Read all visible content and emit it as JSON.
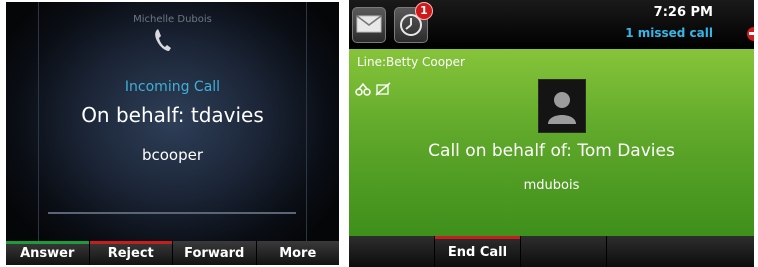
{
  "incoming_screen": {
    "caller_name": "Michelle Dubois",
    "status": "Incoming Call",
    "on_behalf": "On behalf: tdavies",
    "extension": "bcooper",
    "softkeys": [
      {
        "label": "Answer",
        "color": "#1e9b3a"
      },
      {
        "label": "Reject",
        "color": "#c41e1e"
      },
      {
        "label": "Forward",
        "color": ""
      },
      {
        "label": "More",
        "color": ""
      }
    ],
    "icons": {
      "handset": "handset-icon"
    }
  },
  "active_screen": {
    "time": "7:26 PM",
    "missed_calls": "1 missed call",
    "message_badge": "1",
    "line_label": "Line:Betty Cooper",
    "call_on_behalf": "Call on behalf of: Tom Davies",
    "remote_party": "mdubois",
    "softkeys": [
      {
        "label": "",
        "color": ""
      },
      {
        "label": "End Call",
        "color": "#c41e1e"
      },
      {
        "label": "",
        "color": ""
      },
      {
        "label": "",
        "color": ""
      }
    ],
    "icons": {
      "messages": "envelope-icon",
      "recent_calls": "clock-icon",
      "avatar": "contact-avatar-icon",
      "dnd": "do-not-disturb-icon",
      "forward_status": "forward-icon",
      "mute_status": "muted-icon"
    },
    "accent_color": "#6cb42f"
  }
}
